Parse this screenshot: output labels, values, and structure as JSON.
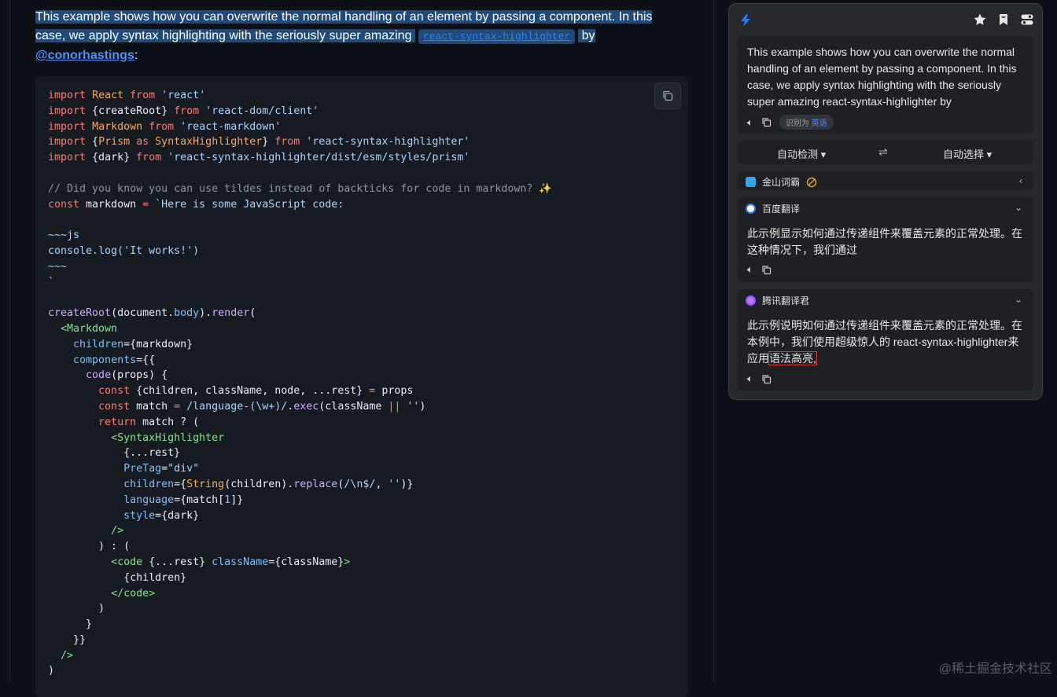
{
  "article": {
    "intro_line1": "This example shows how you can overwrite the normal handling of an element by passing a component. In this",
    "intro_line2": "case, we apply syntax highlighting with the seriously super amazing ",
    "inline_code": "react-syntax-highlighter",
    "intro_by": " by",
    "author_link": "@conorhastings",
    "colon": ":"
  },
  "code": {
    "copy_icon": "copy-icon"
  },
  "translator": {
    "logo_icon": "bolt-icon",
    "icons": [
      "star-icon",
      "bookmark-icon",
      "settings-toggle-icon"
    ],
    "source_text": "This example shows how you can overwrite the normal handling of an element by passing a component. In this case, we apply syntax highlighting with the seriously super amazing react-syntax-highlighter by",
    "detected_label": "识别为",
    "detected_lang": "英语",
    "source_lang": "自动检测",
    "target_lang": "自动选择",
    "swap_icon": "⇌",
    "services": {
      "jinshan": {
        "name": "金山词霸"
      },
      "baidu": {
        "name": "百度翻译",
        "text": "此示例显示如何通过传递组件来覆盖元素的正常处理。在这种情况下，我们通过"
      },
      "tencent": {
        "name": "腾讯翻译君",
        "text_a": "此示例说明如何通过传递组件来覆盖元素的正常处理。在本例中，我们使用超级惊人的 react-syntax-highlighter来应用",
        "text_highlight": "语法高亮,"
      }
    }
  },
  "watermark": "@稀土掘金技术社区",
  "colors": {
    "accent": "#2f81f7",
    "panel_bg": "#26282b",
    "highlight_box": "#e0342f"
  }
}
